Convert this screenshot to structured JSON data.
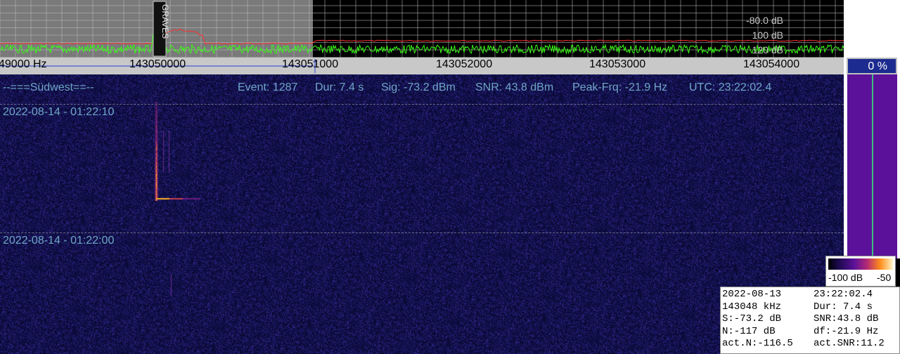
{
  "spectrum": {
    "db_labels": [
      "-80.0 dB",
      "100 dB",
      "120 dB"
    ],
    "vertical_marker_text": "GRAVES"
  },
  "freq_scale": {
    "ticks": [
      "49000 Hz",
      "143050000",
      "143051000",
      "143052000",
      "143053000",
      "143054000"
    ],
    "percent": "0 %"
  },
  "waterfall": {
    "station": "--===Südwest==--",
    "event": "Event: 1287",
    "duration": "Dur: 7.4 s",
    "signal": "Sig: -73.2 dBm",
    "snr": "SNR: 43.8 dBm",
    "peak_freq": "Peak-Frq: -21.9 Hz",
    "utc": "UTC: 23:22:02.4",
    "timestamps": [
      "2022-08-14 - 01:22:10",
      "2022-08-14 - 01:22:00"
    ]
  },
  "legend": {
    "min_label": "-100 dB",
    "max_label": "-50"
  },
  "info": {
    "rows": [
      {
        "left": "2022-08-13",
        "right": "23:22:02.4"
      },
      {
        "left": "143048 kHz",
        "right": "Dur: 7.4 s"
      },
      {
        "left": "S:-73.2 dB",
        "right": "SNR:43.8 dB"
      },
      {
        "left": "N:-117 dB",
        "right": "df:-21.9 Hz"
      },
      {
        "left": "act.N:-116.5",
        "right": "act.SNR:11.2"
      }
    ]
  },
  "colors": {
    "waterfall_bg": "#0e0e47",
    "spectrum_green": "#39ff14",
    "spectrum_red": "#ff3030",
    "level_purple": "#5b1199",
    "label_blue": "#6fa6c8"
  }
}
